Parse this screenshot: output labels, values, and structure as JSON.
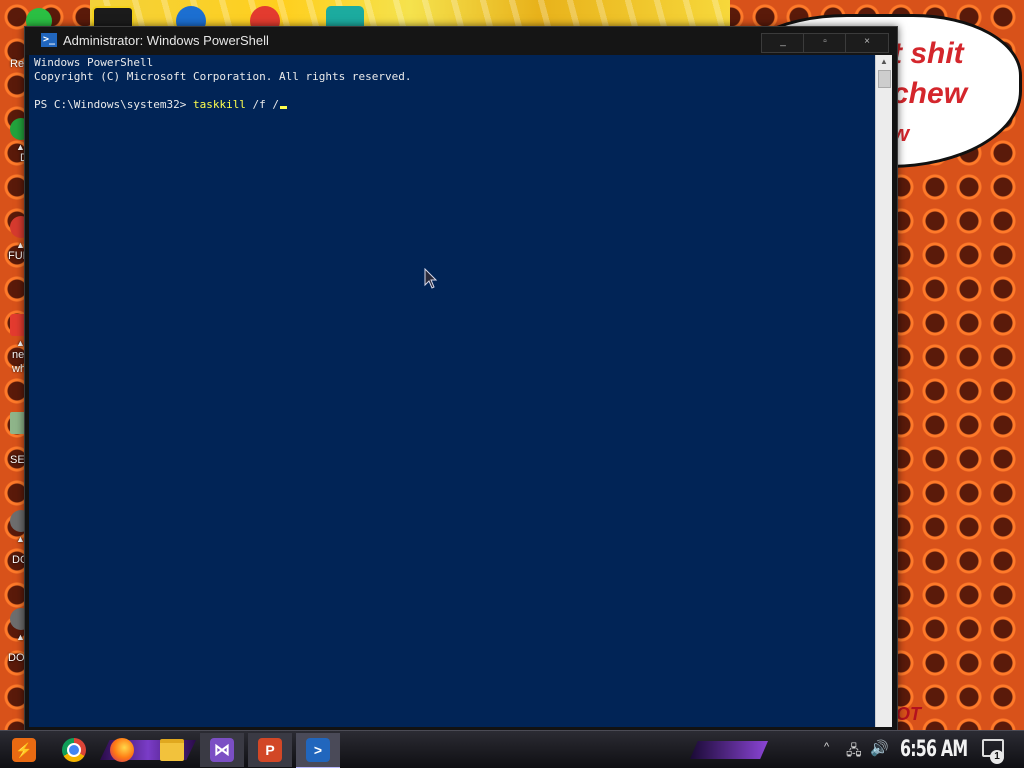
{
  "desktop": {
    "speech_bubble_lines": [
      "t shit",
      "chew",
      "w"
    ],
    "watermark": "OT",
    "shortcuts": [
      {
        "label": "Re",
        "color": "#2bbf43"
      },
      {
        "label": "D",
        "color": "#23a33c"
      },
      {
        "label": "FUR",
        "color": "#d63a2e"
      },
      {
        "label": "ne\nwh",
        "color": "#e33b2f"
      },
      {
        "label": "SEX",
        "color": "#8fb58a"
      },
      {
        "label": "DO",
        "color": "#6e6e6e"
      },
      {
        "label": "DO",
        "color": "#6e6e6e"
      }
    ]
  },
  "window": {
    "title": "Administrator: Windows PowerShell",
    "minimize_glyph": "_",
    "maximize_glyph": "▫",
    "close_glyph": "×",
    "icon_glyph": ">_",
    "console": {
      "header_line_1": "Windows PowerShell",
      "header_line_2": "Copyright (C) Microsoft Corporation. All rights reserved.",
      "prompt": "PS C:\\Windows\\system32> ",
      "command": "taskkill",
      "command_args": " /f /"
    },
    "scrollbar_up_glyph": "▲"
  },
  "taskbar": {
    "apps": [
      {
        "name": "Start",
        "glyph": "⚡",
        "color": "#e96a12"
      },
      {
        "name": "Google Chrome",
        "glyph": "●",
        "color": "#db4437"
      },
      {
        "name": "Firefox",
        "glyph": "◉",
        "color": "#ff7b14"
      },
      {
        "name": "File Explorer",
        "glyph": "▬",
        "color": "#f2c23c"
      },
      {
        "name": "Visual Studio",
        "glyph": "⋈",
        "color": "#7b4fc4"
      },
      {
        "name": "PowerPoint",
        "glyph": "P",
        "color": "#d24726"
      },
      {
        "name": "Windows PowerShell",
        "glyph": ">",
        "color": "#2166bd"
      }
    ],
    "tray_chevron": "^",
    "network_glyph": "🖧",
    "volume_glyph": "🔊",
    "clock": "6:56 AM",
    "notification_count": "1"
  }
}
